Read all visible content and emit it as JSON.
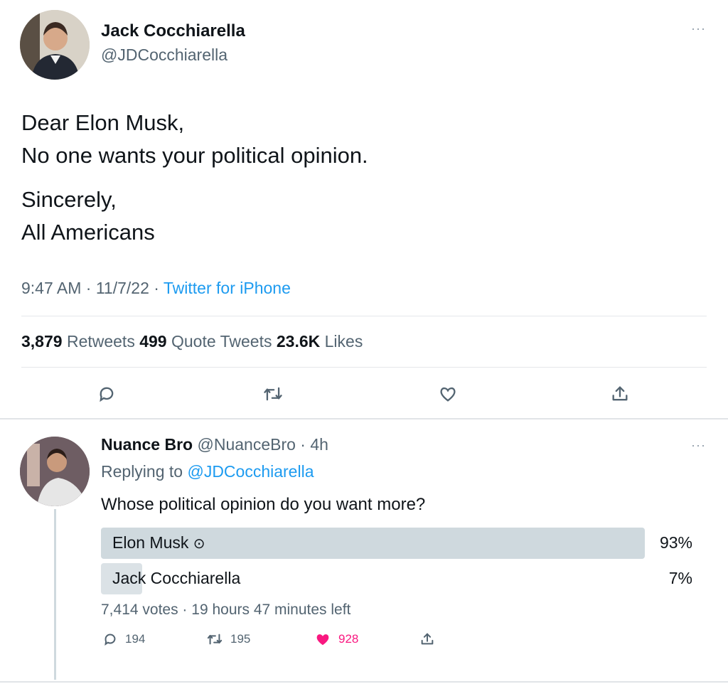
{
  "main_tweet": {
    "author_name": "Jack Cocchiarella",
    "author_handle": "@JDCocchiarella",
    "more_icon": "···",
    "lines": [
      "Dear Elon Musk,",
      "No one wants your political opinion.",
      "Sincerely,",
      "All Americans"
    ],
    "time": "9:47 AM",
    "sep": " · ",
    "date": "11/7/22",
    "source": "Twitter for iPhone",
    "retweets_count": "3,879",
    "retweets_label": " Retweets ",
    "quotes_count": "499",
    "quotes_label": " Quote Tweets ",
    "likes_count": "23.6K",
    "likes_label": " Likes",
    "actions": [
      "reply-icon",
      "retweet-icon",
      "heart-icon",
      "share-icon"
    ]
  },
  "reply_tweet": {
    "author_name": "Nuance Bro",
    "author_handle": " @NuanceBro",
    "age": " · 4h",
    "more_icon": "···",
    "replying_prefix": "Replying to ",
    "replying_handle": "@JDCocchiarella",
    "question": "Whose political opinion do you want more?",
    "poll": {
      "options": [
        {
          "label": "Elon Musk",
          "percent_text": "93%",
          "percent": 93,
          "check_icon": "⊙"
        },
        {
          "label": "Jack Cocchiarella",
          "percent_text": "7%",
          "percent": 7
        }
      ],
      "votes": "7,414 votes",
      "time_left": "19 hours 47 minutes left"
    },
    "replies": "194",
    "retweets": "195",
    "likes": "928",
    "colors": {
      "like": "#f91880",
      "link": "#1d9bf0"
    }
  }
}
